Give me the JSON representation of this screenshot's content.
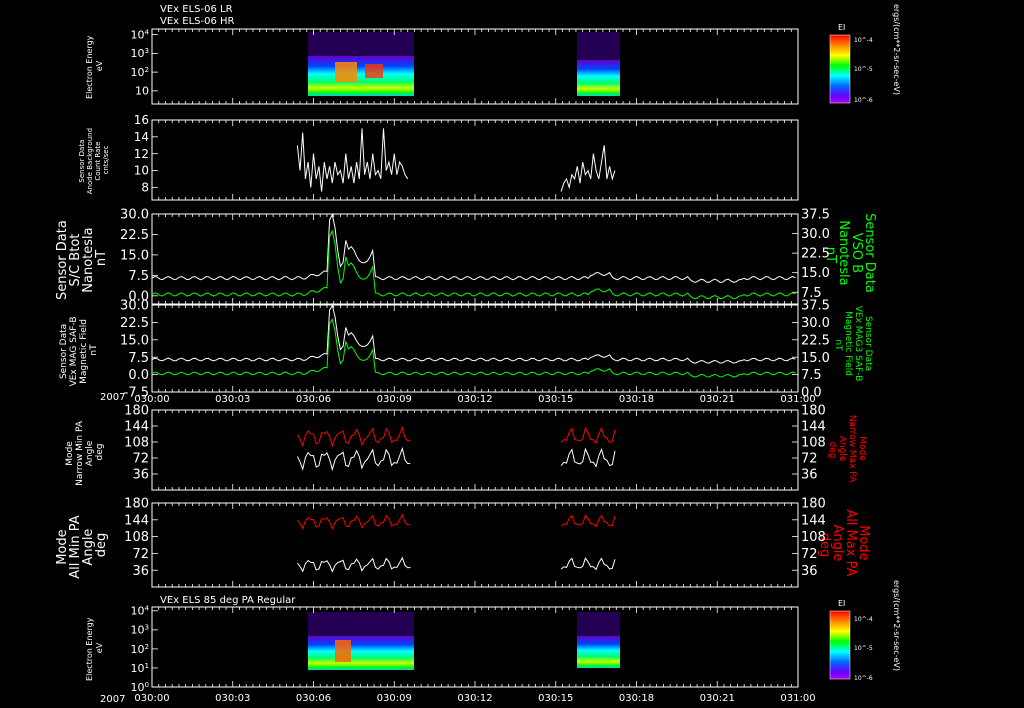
{
  "header": {
    "line1": "VEx ELS-06 LR",
    "line2": "VEx ELS-06 HR",
    "panel7_title": "VEx ELS 85 deg PA Regular"
  },
  "colors": {
    "white": "#ffffff",
    "green": "#00ff00",
    "red": "#ff0000",
    "background": "#000000"
  },
  "chart_data": {
    "type": "line",
    "x_axis": {
      "year": "2007",
      "ticks": [
        "030:00",
        "030:03",
        "030:06",
        "030:09",
        "030:12",
        "030:15",
        "030:18",
        "030:21",
        "031:00"
      ]
    },
    "panels": [
      {
        "id": "electron_energy_top",
        "type": "heatmap",
        "ylabel": [
          "Electron Energy",
          "eV"
        ],
        "yticks": [
          "10",
          "10^2",
          "10^3",
          "10^4"
        ],
        "scale": "log",
        "colorbar": {
          "title": "EI",
          "ticks": [
            "10^-4",
            "10^-5",
            "10^-6"
          ],
          "side_label": "ergs/(cm**2-sr-sec-eV)"
        },
        "data_intervals": [
          [
            "030:05.4",
            "030:09.6"
          ],
          [
            "030:15.2",
            "030:17.3"
          ]
        ]
      },
      {
        "id": "count_rate",
        "ylabel": [
          "Sensor Data",
          "Anode Background",
          "Count Rate",
          "cnts/sec"
        ],
        "yticks": [
          "8",
          "10",
          "12",
          "14",
          "16"
        ],
        "ylim": [
          6.5,
          16
        ],
        "series": [
          {
            "color": "#ffffff",
            "x": [
              5.4,
              5.5,
              5.6,
              5.7,
              5.8,
              5.9,
              6.0,
              6.1,
              6.2,
              6.3,
              6.4,
              6.5,
              6.6,
              6.7,
              6.8,
              6.9,
              7.0,
              7.1,
              7.2,
              7.3,
              7.4,
              7.5,
              7.6,
              7.7,
              7.8,
              7.9,
              8.0,
              8.1,
              8.2,
              8.3,
              8.4,
              8.5,
              8.6,
              8.7,
              8.8,
              8.9,
              9.0,
              9.1,
              9.2,
              9.3,
              9.4,
              9.5
            ],
            "y": [
              13,
              10,
              14.5,
              9,
              11,
              8,
              12,
              9,
              10.5,
              7.5,
              11,
              9,
              10.5,
              8.5,
              11,
              9.5,
              10,
              8.5,
              12,
              9,
              10.5,
              8.5,
              11,
              9,
              15,
              9.5,
              11,
              9,
              12,
              9.5,
              10,
              9,
              15,
              10,
              11,
              9.5,
              12,
              9.5,
              11,
              10.5,
              9.5,
              9
            ]
          },
          {
            "color": "#ffffff",
            "x": [
              15.2,
              15.3,
              15.4,
              15.5,
              15.6,
              15.7,
              15.8,
              15.9,
              16.0,
              16.1,
              16.2,
              16.3,
              16.4,
              16.5,
              16.6,
              16.7,
              16.8,
              16.9,
              17.0,
              17.1,
              17.2
            ],
            "y": [
              7.5,
              8.5,
              9,
              8,
              9.5,
              9,
              10.5,
              8.5,
              11,
              9.5,
              10,
              9,
              12,
              10,
              9,
              11,
              13,
              9,
              10.5,
              9,
              10
            ]
          }
        ]
      },
      {
        "id": "sc_btot",
        "ylabel": [
          "Sensor Data",
          "S/C Btot",
          "Nanotesla",
          "nT"
        ],
        "yticks_left": [
          "0.0",
          "7.5",
          "15.0",
          "22.5",
          "30.0"
        ],
        "ylim_left": [
          -3,
          30
        ],
        "ylabel_right": [
          "Sensor Data",
          "VSO B",
          "Nanotesla",
          "nT"
        ],
        "yticks_right": [
          "7.5",
          "15.0",
          "22.5",
          "30.0",
          "37.5"
        ]
      },
      {
        "id": "mag_field",
        "ylabel": [
          "Sensor Data",
          "VEx MAG SAF-B",
          "Magnetic Field",
          "nT"
        ],
        "yticks_left": [
          "-7.5",
          "0.0",
          "7.5",
          "15.0",
          "22.5",
          "30.0"
        ],
        "ylim_left": [
          -7.5,
          30
        ],
        "ylabel_right": [
          "Sensor Data",
          "VEx MAG3 SAF-B",
          "Magnetic Field",
          "nT"
        ],
        "yticks_right": [
          "0.0",
          "7.5",
          "15.0",
          "22.5",
          "30.0",
          "37.5"
        ]
      },
      {
        "id": "narrow_pa",
        "ylabel": [
          "Mode",
          "Narrow Min PA",
          "Angle",
          "deg"
        ],
        "yticks": [
          "36",
          "72",
          "108",
          "144",
          "180"
        ],
        "ylim": [
          0,
          180
        ],
        "ylabel_right": [
          "Mode",
          "Narrow Max PA",
          "Angle",
          "deg"
        ],
        "yticks_right": [
          "36",
          "72",
          "108",
          "144",
          "180"
        ]
      },
      {
        "id": "all_pa",
        "ylabel": [
          "Mode",
          "All Min PA",
          "Angle",
          "deg"
        ],
        "yticks": [
          "36",
          "72",
          "108",
          "144",
          "180"
        ],
        "ylim": [
          0,
          180
        ],
        "ylabel_right": [
          "Mode",
          "All Max PA",
          "Angle",
          "deg"
        ],
        "yticks_right": [
          "36",
          "72",
          "108",
          "144",
          "180"
        ]
      },
      {
        "id": "electron_energy_bottom",
        "type": "heatmap",
        "ylabel": [
          "Electron Energy",
          "eV"
        ],
        "yticks": [
          "10^0",
          "10^1",
          "10^2",
          "10^3",
          "10^4"
        ],
        "scale": "log",
        "colorbar": {
          "title": "EI",
          "ticks": [
            "10^-4",
            "10^-5",
            "10^-6"
          ],
          "side_label": "ergs/(cm**2-sr-sec-eV)"
        },
        "data_intervals": [
          [
            "030:05.4",
            "030:09.6"
          ],
          [
            "030:15.2",
            "030:17.3"
          ]
        ]
      }
    ]
  }
}
